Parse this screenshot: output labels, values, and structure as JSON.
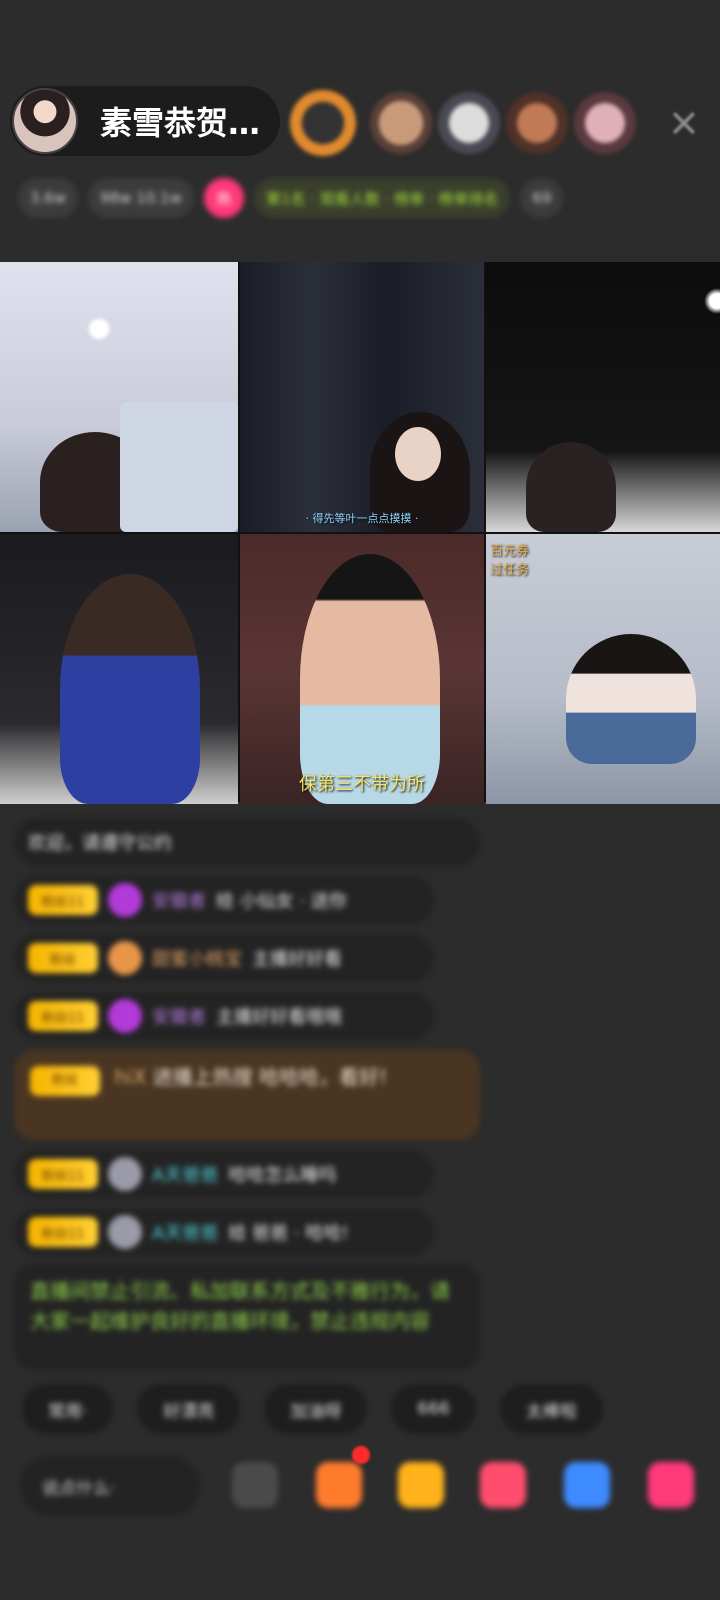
{
  "host": {
    "name": "素雪恭贺…"
  },
  "viewers": [
    {
      "name": "viewer-1",
      "color": "#d4823a"
    },
    {
      "name": "viewer-2",
      "color": "#b98a70"
    },
    {
      "name": "viewer-3",
      "color": "#a7a7b1"
    },
    {
      "name": "viewer-4",
      "color": "#b07050"
    },
    {
      "name": "viewer-5",
      "color": "#c08890"
    }
  ],
  "close_icon": "close-icon",
  "info_bar": {
    "items": [
      "3.6w",
      "98w 10.1w",
      "热",
      "第1名 · 观看人数 · 榜单 · 榜单排名",
      "69"
    ]
  },
  "video_tiles": [
    {
      "caption": ""
    },
    {
      "caption": "· 得先等叶一点点摸摸 ·"
    },
    {
      "caption": ""
    },
    {
      "caption": ""
    },
    {
      "caption": "保第三不带为所"
    },
    {
      "caption": "百元券 过任务"
    }
  ],
  "chat": {
    "welcome": "欢迎，请遵守公约",
    "messages": [
      {
        "badge": "粉丝11",
        "user": "安徽者",
        "text": "给 小仙女 · 送你"
      },
      {
        "badge": "粉丝",
        "user": "甜蜜小桃宝",
        "text": "主播好好看"
      },
      {
        "badge": "粉丝11",
        "user": "安徽者",
        "text": "主播好好看哦哦"
      },
      {
        "badge": "粉丝",
        "user": "hiX",
        "text": "进播上热搜 哈哈哈，看好!"
      },
      {
        "badge": "粉丝11",
        "user": "A天爸爸",
        "text": "哈哈怎么睡吗"
      },
      {
        "badge": "粉丝11",
        "user": "A天爸爸",
        "text": "给 爸爸 · 哈哈!"
      }
    ],
    "system_notice": "直播间禁止引流、私加联系方式及不雅行为，请大家一起维护良好的直播环境，禁止违规内容"
  },
  "quick_actions": [
    "常用·",
    "好漂亮",
    "加油呀",
    "666",
    "太棒啦"
  ],
  "input": {
    "placeholder": "说点什么·"
  },
  "tools": [
    {
      "icon": "emoji-icon",
      "color": "#4a4a4a"
    },
    {
      "icon": "gift-box-icon",
      "color": "#ff7b2c"
    },
    {
      "icon": "treasure-icon",
      "color": "#ffb21a"
    },
    {
      "icon": "fan-club-icon",
      "color": "#ff4d6d"
    },
    {
      "icon": "game-icon",
      "color": "#3d8bff"
    },
    {
      "icon": "gift-icon",
      "color": "#ff3a7a"
    }
  ]
}
